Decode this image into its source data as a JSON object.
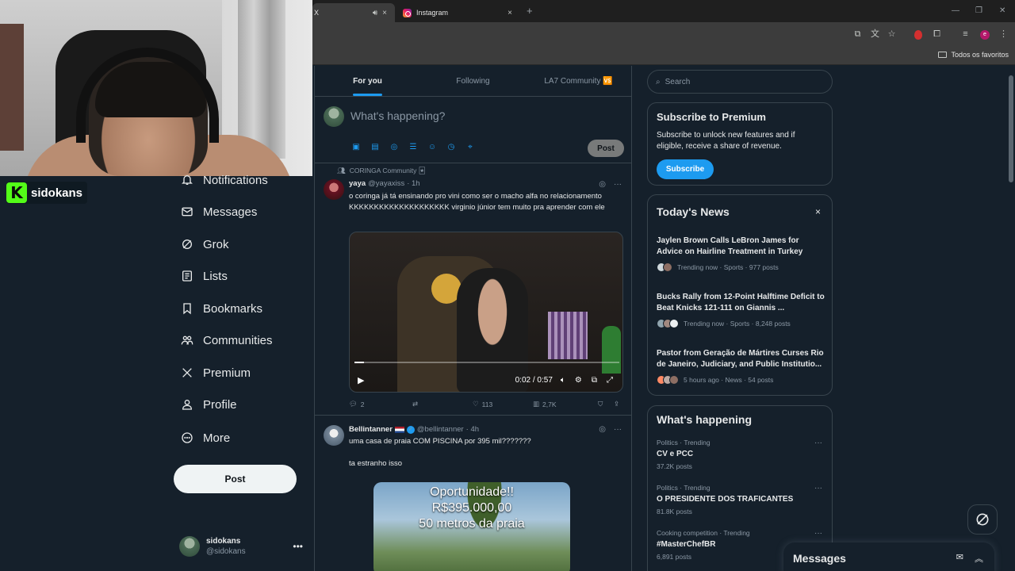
{
  "browser": {
    "tab1": {
      "title": "X",
      "mute_icon": "speaker-icon",
      "close": "×"
    },
    "tab2": {
      "title": "Instagram",
      "close": "×"
    },
    "new_tab": "+",
    "bookmarks_folder": "Todos os favoritos",
    "profile_initial": "e"
  },
  "streamer": {
    "name": "sidokans"
  },
  "nav": {
    "items": [
      {
        "label": "Notifications",
        "icon": "bell-icon"
      },
      {
        "label": "Messages",
        "icon": "envelope-icon"
      },
      {
        "label": "Grok",
        "icon": "grok-icon"
      },
      {
        "label": "Lists",
        "icon": "list-icon"
      },
      {
        "label": "Bookmarks",
        "icon": "bookmark-icon"
      },
      {
        "label": "Communities",
        "icon": "people-icon"
      },
      {
        "label": "Premium",
        "icon": "x-logo-icon"
      },
      {
        "label": "Profile",
        "icon": "person-icon"
      },
      {
        "label": "More",
        "icon": "more-circle-icon"
      }
    ],
    "post_label": "Post",
    "account": {
      "name": "sidokans",
      "handle": "@sidokans"
    }
  },
  "feed": {
    "tabs": [
      "For you",
      "Following",
      "LA7 Community 🆚"
    ],
    "active_tab": "For you",
    "compose_placeholder": "What's happening?",
    "compose_post": "Post",
    "tweets": [
      {
        "context": "CORINGA Community 🃏",
        "name": "yaya",
        "handle": "@yayaxiss",
        "time": "· 1h",
        "text": "o coringa já tá ensinando pro vini como ser o macho alfa no relacionamento KKKKKKKKKKKKKKKKKKKK virginio júnior tem muito pra aprender com ele",
        "video_time": "0:02 / 0:57",
        "video_progress": 0.035,
        "replies": "2",
        "retweets": "",
        "likes": "113",
        "views": "2,7K"
      },
      {
        "name": "Bellintanner",
        "handle": "@bellintanner",
        "time": "· 4h",
        "text": "uma casa de praia COM PISCINA por 395 mil???????\n\nta estranho isso",
        "image_lines": [
          "Oportunidade!!",
          "R$395.000,00",
          "50 metros da praia"
        ]
      }
    ]
  },
  "right": {
    "search_placeholder": "Search",
    "premium": {
      "title": "Subscribe to Premium",
      "body": "Subscribe to unlock new features and if eligible, receive a share of revenue.",
      "button": "Subscribe"
    },
    "news": {
      "title": "Today's News",
      "close": "×",
      "items": [
        {
          "headline": "Jaylen Brown Calls LeBron James for Advice on Hairline Treatment in Turkey",
          "meta": "Trending now · Sports · 977 posts"
        },
        {
          "headline": "Bucks Rally from 12-Point Halftime Deficit to Beat Knicks 121-111 on Giannis ...",
          "meta": "Trending now · Sports · 8,248 posts"
        },
        {
          "headline": "Pastor from Geração de Mártires Curses Rio de Janeiro, Judiciary, and Public Institutio...",
          "meta": "5 hours ago · News · 54 posts"
        }
      ]
    },
    "happening": {
      "title": "What's happening",
      "trends": [
        {
          "category": "Politics · Trending",
          "name": "CV e PCC",
          "posts": "37.2K posts"
        },
        {
          "category": "Politics · Trending",
          "name": "O PRESIDENTE DOS TRAFICANTES",
          "posts": "81.8K posts"
        },
        {
          "category": "Cooking competition · Trending",
          "name": "#MasterChefBR",
          "posts": "6,891 posts"
        }
      ]
    },
    "messages_drawer": "Messages"
  },
  "colors": {
    "background": "#15202b",
    "accent": "#1d9bf0",
    "border": "#38444d",
    "text_secondary": "#8b98a5"
  }
}
